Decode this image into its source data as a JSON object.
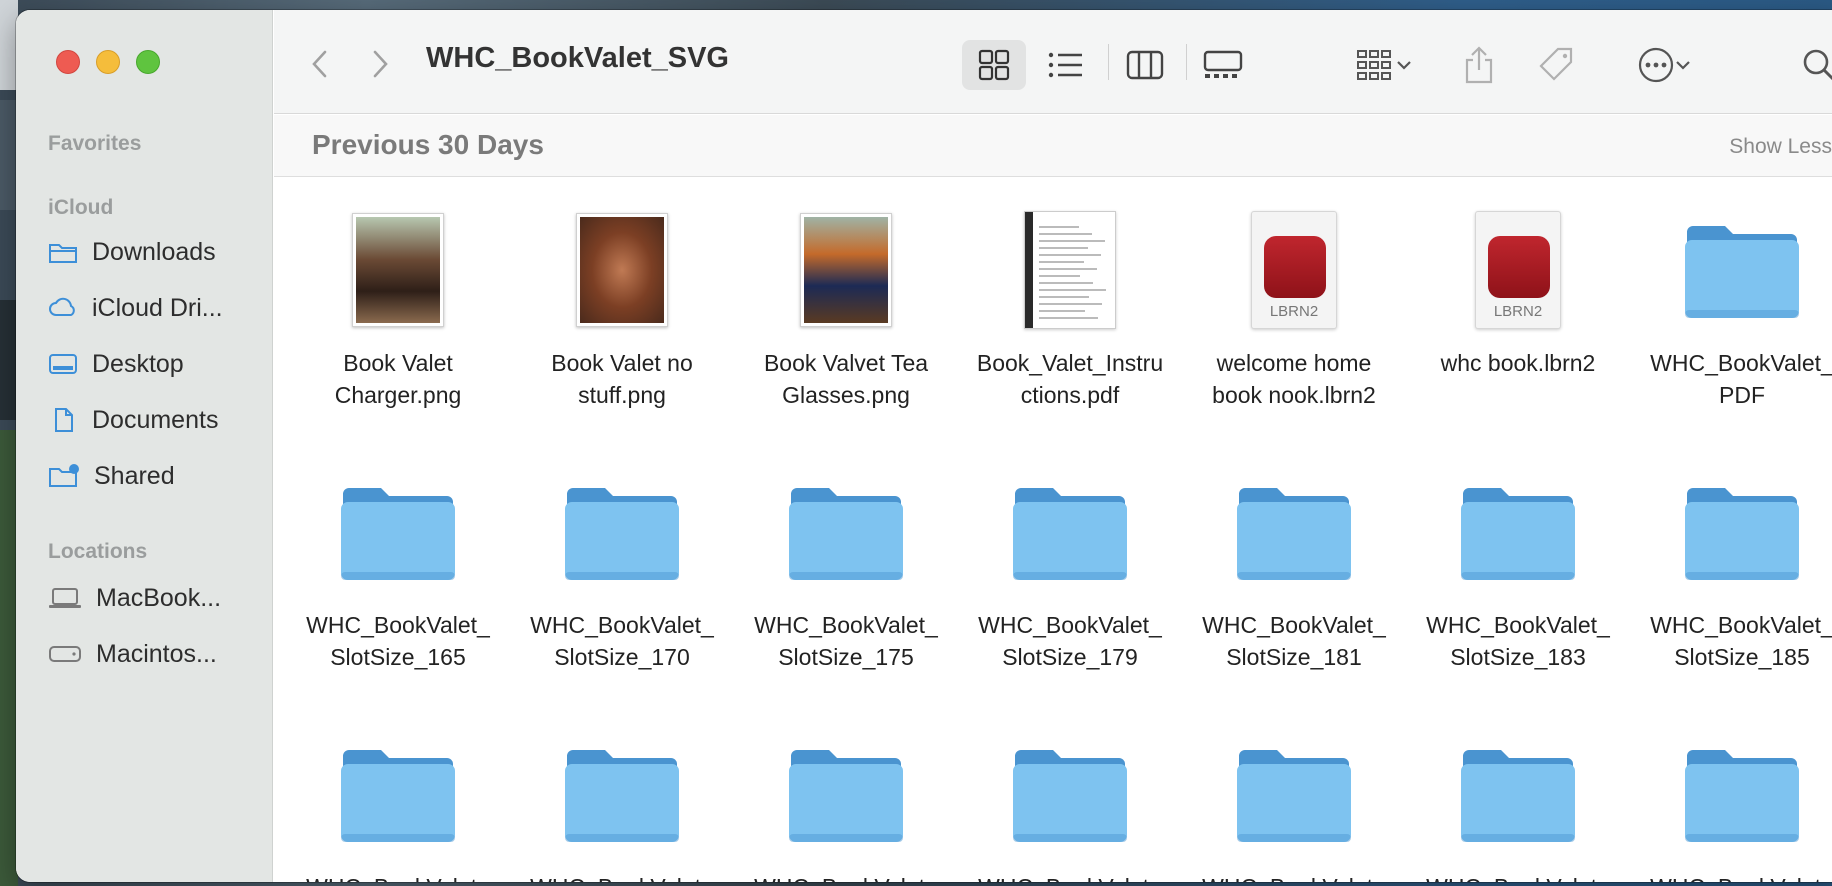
{
  "window": {
    "title": "WHC_BookValet_SVG"
  },
  "sidebar": {
    "favorites_label": "Favorites",
    "icloud_label": "iCloud",
    "locations_label": "Locations",
    "items": [
      {
        "label": "Downloads",
        "icon": "downloads-folder-icon"
      },
      {
        "label": "iCloud Dri...",
        "icon": "cloud-icon"
      },
      {
        "label": "Desktop",
        "icon": "desktop-icon"
      },
      {
        "label": "Documents",
        "icon": "document-icon"
      },
      {
        "label": "Shared",
        "icon": "shared-folder-icon"
      },
      {
        "label": "MacBook...",
        "icon": "laptop-icon"
      },
      {
        "label": "Macintos...",
        "icon": "disk-icon"
      }
    ]
  },
  "toolbar": {
    "show_less": "Show Less"
  },
  "group": {
    "title": "Previous 30 Days"
  },
  "files": [
    {
      "name": "Book Valet\nCharger.png",
      "kind": "image"
    },
    {
      "name": "Book Valet no\nstuff.png",
      "kind": "image"
    },
    {
      "name": "Book Valvet Tea\nGlasses.png",
      "kind": "image"
    },
    {
      "name": "Book_Valet_Instru\nctions.pdf",
      "kind": "pdf"
    },
    {
      "name": "welcome home\nbook nook.lbrn2",
      "kind": "lbrn2",
      "badge": "LBRN2"
    },
    {
      "name": "whc book.lbrn2",
      "kind": "lbrn2",
      "badge": "LBRN2"
    },
    {
      "name": "WHC_BookValet_\nPDF",
      "kind": "folder"
    },
    {
      "name": "WHC_BookValet_\nSlotSize_165",
      "kind": "folder"
    },
    {
      "name": "WHC_BookValet_\nSlotSize_170",
      "kind": "folder"
    },
    {
      "name": "WHC_BookValet_\nSlotSize_175",
      "kind": "folder"
    },
    {
      "name": "WHC_BookValet_\nSlotSize_179",
      "kind": "folder"
    },
    {
      "name": "WHC_BookValet_\nSlotSize_181",
      "kind": "folder"
    },
    {
      "name": "WHC_BookValet_\nSlotSize_183",
      "kind": "folder"
    },
    {
      "name": "WHC_BookValet_\nSlotSize_185",
      "kind": "folder"
    },
    {
      "name": "WHC_BookValet_",
      "kind": "folder"
    },
    {
      "name": "WHC_BookValet_",
      "kind": "folder"
    },
    {
      "name": "WHC_BookValet_",
      "kind": "folder"
    },
    {
      "name": "WHC_BookValet_",
      "kind": "folder"
    },
    {
      "name": "WHC_BookValet_",
      "kind": "folder"
    },
    {
      "name": "WHC_BookValet_",
      "kind": "folder"
    },
    {
      "name": "WHC_BookValet_",
      "kind": "folder"
    }
  ],
  "colors": {
    "folder": "#7ec3f0",
    "folder_dark": "#4a94d0",
    "sidebar_icon": "#3d8fd8"
  }
}
